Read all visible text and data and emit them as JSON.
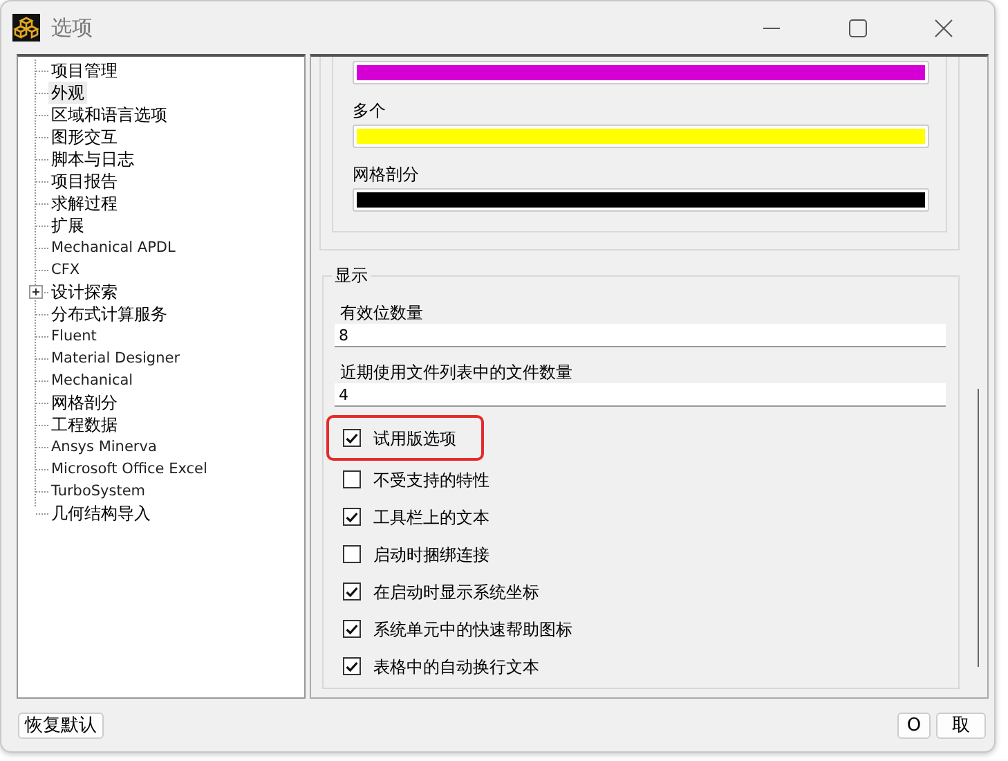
{
  "window": {
    "title": "选项"
  },
  "tree": [
    {
      "label": "项目管理",
      "selected": false
    },
    {
      "label": "外观",
      "selected": true
    },
    {
      "label": "区域和语言选项",
      "selected": false
    },
    {
      "label": "图形交互",
      "selected": false
    },
    {
      "label": "脚本与日志",
      "selected": false
    },
    {
      "label": "项目报告",
      "selected": false
    },
    {
      "label": "求解过程",
      "selected": false
    },
    {
      "label": "扩展",
      "selected": false
    },
    {
      "label": "Mechanical APDL",
      "selected": false
    },
    {
      "label": "CFX",
      "selected": false
    },
    {
      "label": "设计探索",
      "selected": false,
      "expanded": false
    },
    {
      "label": "分布式计算服务",
      "selected": false
    },
    {
      "label": "Fluent",
      "selected": false
    },
    {
      "label": "Material Designer",
      "selected": false
    },
    {
      "label": "Mechanical",
      "selected": false
    },
    {
      "label": "网格剖分",
      "selected": false
    },
    {
      "label": "工程数据",
      "selected": false
    },
    {
      "label": "Ansys Minerva",
      "selected": false
    },
    {
      "label": "Microsoft Office Excel",
      "selected": false
    },
    {
      "label": "TurboSystem",
      "selected": false
    },
    {
      "label": "几何结构导入",
      "selected": false
    }
  ],
  "colors": [
    {
      "color": "#d600d6"
    },
    {
      "label": "多个",
      "color": "#ffff00"
    },
    {
      "label": "网格剖分",
      "color": "#000000"
    }
  ],
  "display": {
    "title": "显示",
    "fields": [
      {
        "label": "有效位数量",
        "value": "8"
      },
      {
        "label": "近期使用文件列表中的文件数量",
        "value": "4"
      }
    ],
    "checkboxes": [
      {
        "label": "试用版选项",
        "checked": true,
        "highlighted": true
      },
      {
        "label": "不受支持的特性",
        "checked": false,
        "highlighted": false
      },
      {
        "label": "工具栏上的文本",
        "checked": true,
        "highlighted": false
      },
      {
        "label": "启动时捆绑连接",
        "checked": false,
        "highlighted": false
      },
      {
        "label": "在启动时显示系统坐标",
        "checked": true,
        "highlighted": false
      },
      {
        "label": "系统单元中的快速帮助图标",
        "checked": true,
        "highlighted": false
      },
      {
        "label": "表格中的自动换行文本",
        "checked": true,
        "highlighted": false
      }
    ]
  },
  "buttons": {
    "restore": "恢复默认",
    "ok": "O",
    "cancel": "取"
  }
}
